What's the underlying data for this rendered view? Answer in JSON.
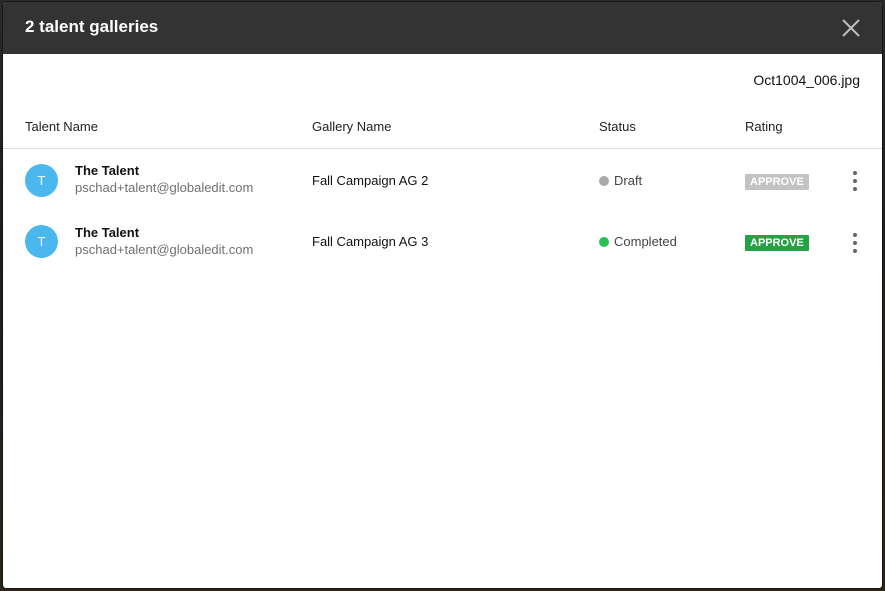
{
  "modal": {
    "title": "2 talent galleries",
    "filename": "Oct1004_006.jpg"
  },
  "table": {
    "columns": [
      "Talent Name",
      "Gallery Name",
      "Status",
      "Rating"
    ],
    "rows": [
      {
        "avatar_initial": "T",
        "talent_name": "The Talent",
        "talent_email": "pschad+talent@globaledit.com",
        "gallery_name": "Fall Campaign AG 2",
        "status": "Draft",
        "status_color": "#a8a8a8",
        "rating": "APPROVE",
        "rating_color": "#c3c3c3"
      },
      {
        "avatar_initial": "T",
        "talent_name": "The Talent",
        "talent_email": "pschad+talent@globaledit.com",
        "gallery_name": "Fall Campaign AG 3",
        "status": "Completed",
        "status_color": "#2bbf55",
        "rating": "APPROVE",
        "rating_color": "#25a244"
      }
    ]
  },
  "icons": {
    "close": "close-icon",
    "more": "more-vertical-icon"
  },
  "colors": {
    "header_bg": "#333333",
    "avatar_bg": "#4ab8ef"
  }
}
